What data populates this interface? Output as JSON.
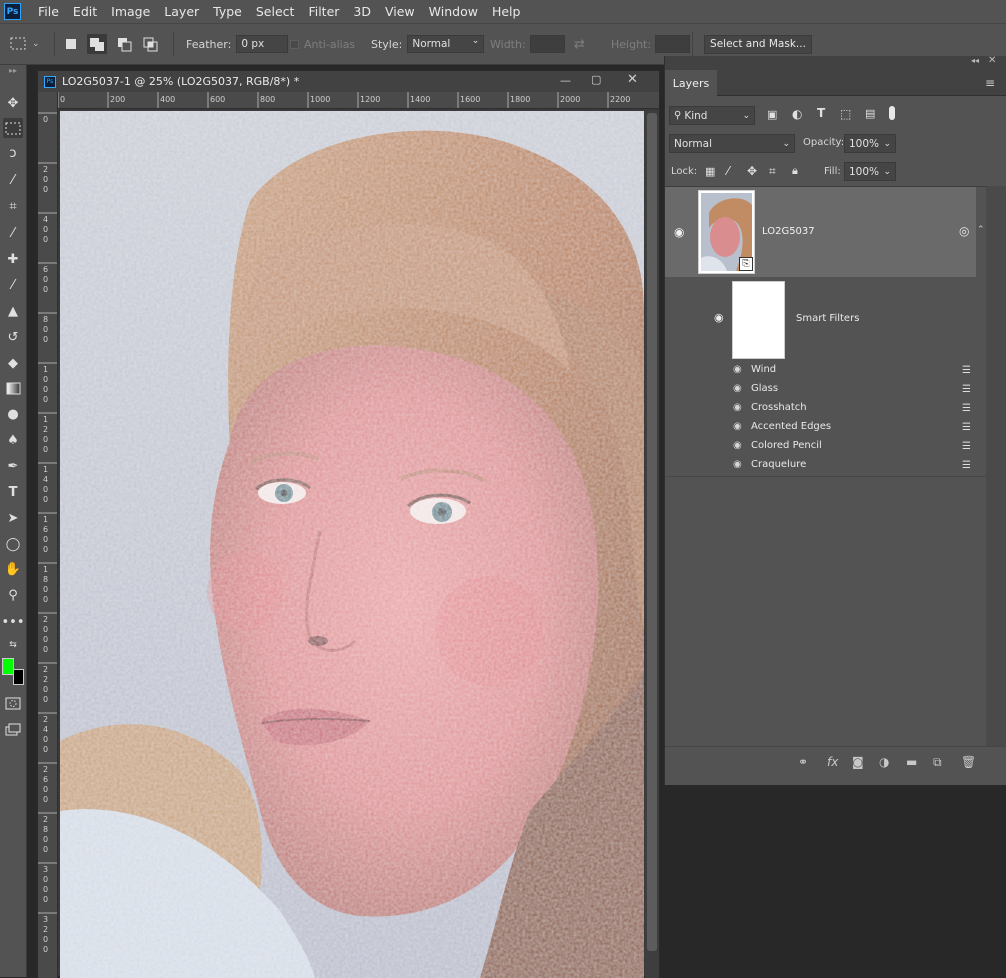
{
  "app": {
    "logo": "Ps"
  },
  "menu": [
    "File",
    "Edit",
    "Image",
    "Layer",
    "Type",
    "Select",
    "Filter",
    "3D",
    "View",
    "Window",
    "Help"
  ],
  "options": {
    "feather_label": "Feather:",
    "feather_value": "0 px",
    "antialias_label": "Anti-alias",
    "style_label": "Style:",
    "style_value": "Normal",
    "width_label": "Width:",
    "height_label": "Height:",
    "select_mask": "Select and Mask..."
  },
  "document": {
    "title": "LO2G5037-1 @ 25% (LO2G5037, RGB/8*) *",
    "ruler_h": [
      "0",
      "200",
      "400",
      "600",
      "800",
      "1000",
      "1200",
      "1400",
      "1600",
      "1800",
      "2000",
      "2200"
    ],
    "ruler_v": [
      "0",
      "2\n0\n0",
      "4\n0\n0",
      "6\n0\n0",
      "8\n0\n0",
      "1\n0\n0\n0",
      "1\n2\n0\n0",
      "1\n4\n0\n0",
      "1\n6\n0\n0",
      "1\n8\n0\n0",
      "2\n0\n0\n0",
      "2\n2\n0\n0",
      "2\n4\n0\n0",
      "2\n6\n0\n0",
      "2\n8\n0\n0",
      "3\n0\n0\n0",
      "3\n2\n0\n0"
    ]
  },
  "layers_panel": {
    "tab": "Layers",
    "kind_filter": "Kind",
    "blend_mode": "Normal",
    "opacity_label": "Opacity:",
    "opacity_value": "100%",
    "lock_label": "Lock:",
    "fill_label": "Fill:",
    "fill_value": "100%",
    "layer_name": "LO2G5037",
    "smart_filters_label": "Smart Filters",
    "filters": [
      "Wind",
      "Glass",
      "Crosshatch",
      "Accented Edges",
      "Colored Pencil",
      "Craquelure"
    ]
  },
  "colors": {
    "foreground": "#00ff00",
    "background": "#000000",
    "accent": "#31a8ff"
  }
}
